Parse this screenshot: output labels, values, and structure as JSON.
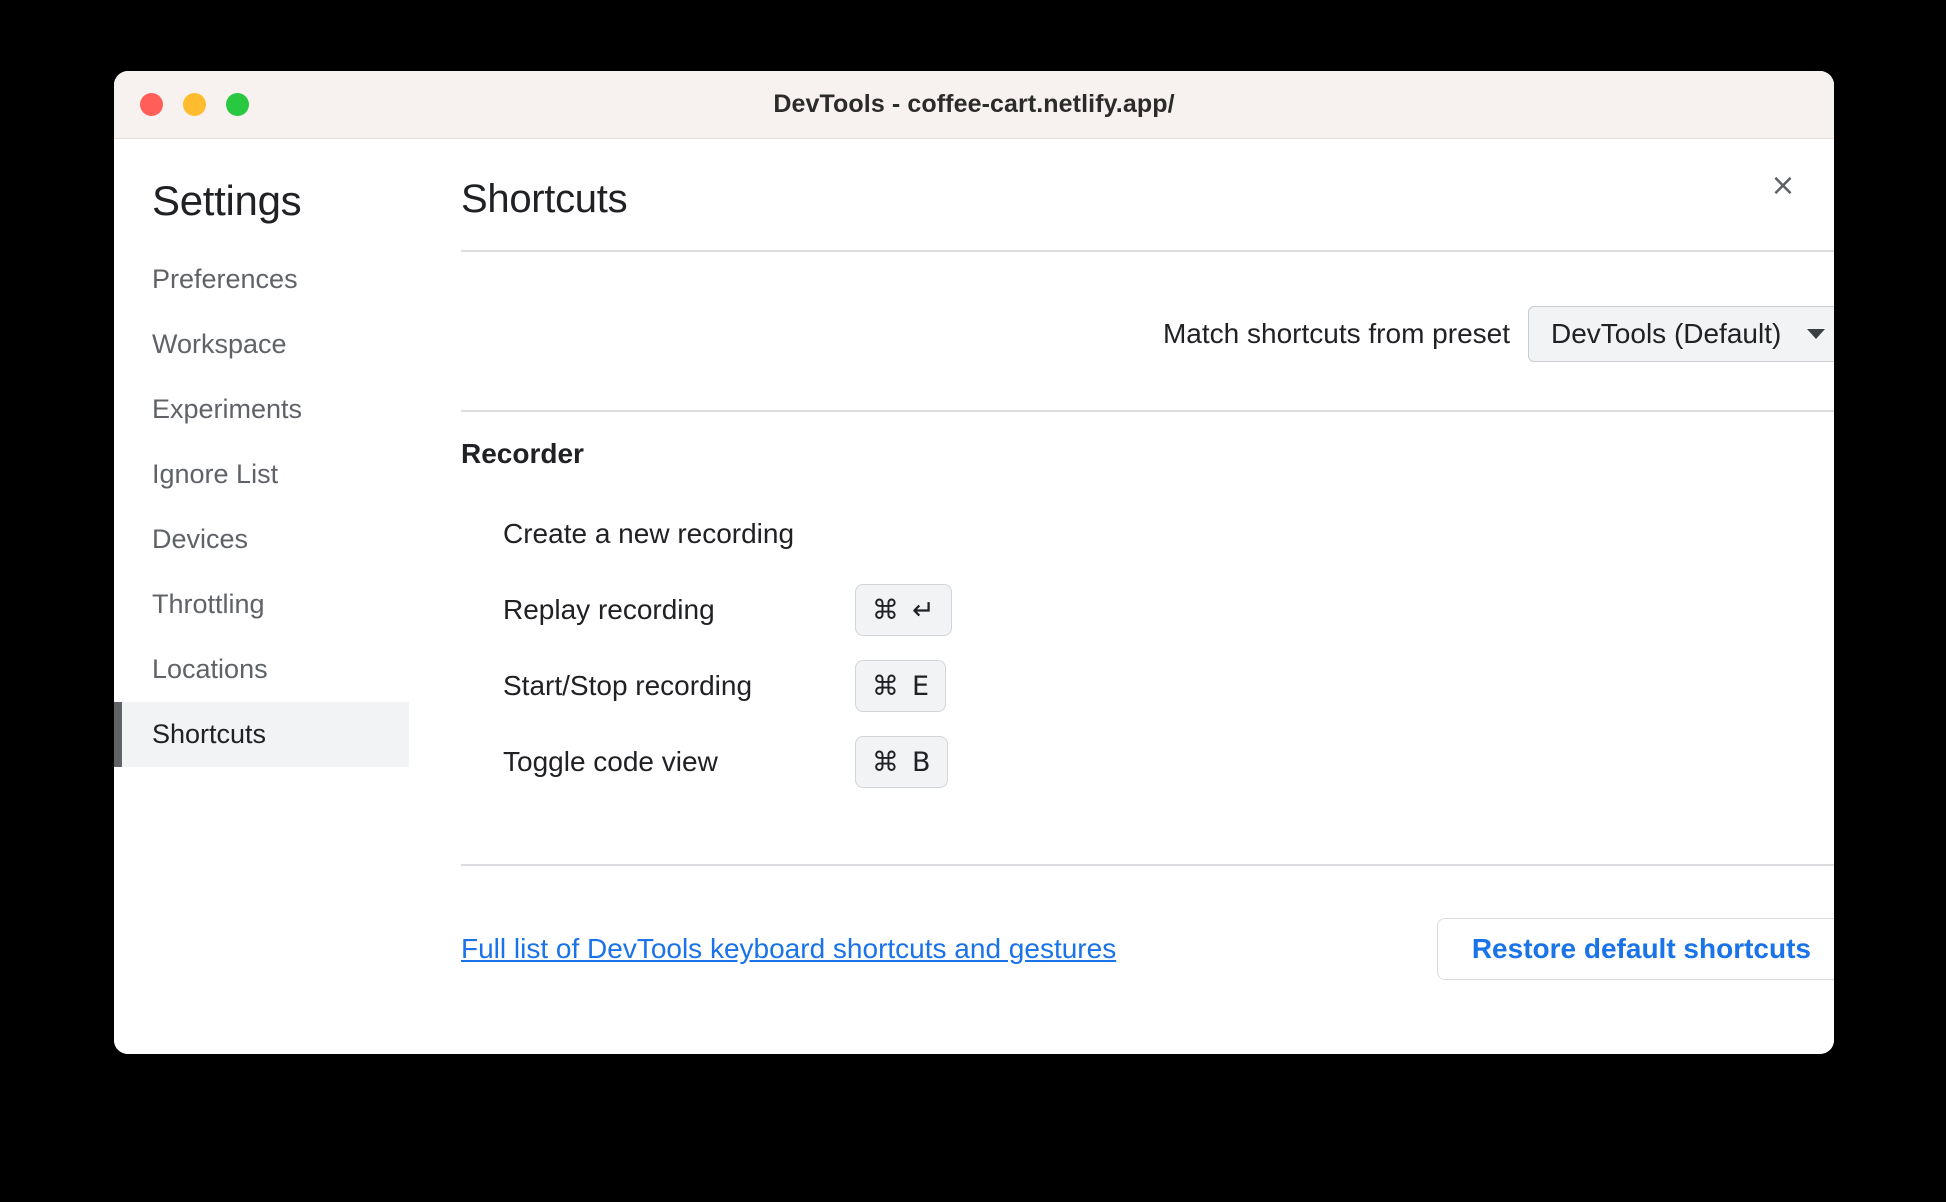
{
  "window": {
    "title": "DevTools - coffee-cart.netlify.app/",
    "traffic_lights": [
      {
        "name": "close",
        "color": "#ff5f57"
      },
      {
        "name": "minimize",
        "color": "#febc2e"
      },
      {
        "name": "maximize",
        "color": "#28c840"
      }
    ]
  },
  "dialog": {
    "close_icon": "×"
  },
  "sidebar": {
    "title": "Settings",
    "items": [
      {
        "label": "Preferences",
        "selected": false
      },
      {
        "label": "Workspace",
        "selected": false
      },
      {
        "label": "Experiments",
        "selected": false
      },
      {
        "label": "Ignore List",
        "selected": false
      },
      {
        "label": "Devices",
        "selected": false
      },
      {
        "label": "Throttling",
        "selected": false
      },
      {
        "label": "Locations",
        "selected": false
      },
      {
        "label": "Shortcuts",
        "selected": true
      }
    ]
  },
  "main": {
    "page_title": "Shortcuts",
    "preset": {
      "label": "Match shortcuts from preset",
      "selected_option": "DevTools (Default)",
      "caret_icon": "chevron-down-icon"
    },
    "sections": [
      {
        "title": "Recorder",
        "shortcuts": [
          {
            "name": "Create a new recording",
            "keys": []
          },
          {
            "name": "Replay recording",
            "keys": [
              {
                "mod": "⌘",
                "key": "↵"
              }
            ]
          },
          {
            "name": "Start/Stop recording",
            "keys": [
              {
                "mod": "⌘",
                "key": "E"
              }
            ]
          },
          {
            "name": "Toggle code view",
            "keys": [
              {
                "mod": "⌘",
                "key": "B"
              }
            ]
          }
        ]
      }
    ],
    "footer": {
      "link_text": "Full list of DevTools keyboard shortcuts and gestures",
      "restore_button": "Restore default shortcuts"
    }
  },
  "colors": {
    "accent_blue": "#1a73e8",
    "selected_bg": "#f1f3f4",
    "selected_bar": "#5f6368",
    "titlebar_bg": "#f7f2ef",
    "divider": "#dadce0"
  }
}
